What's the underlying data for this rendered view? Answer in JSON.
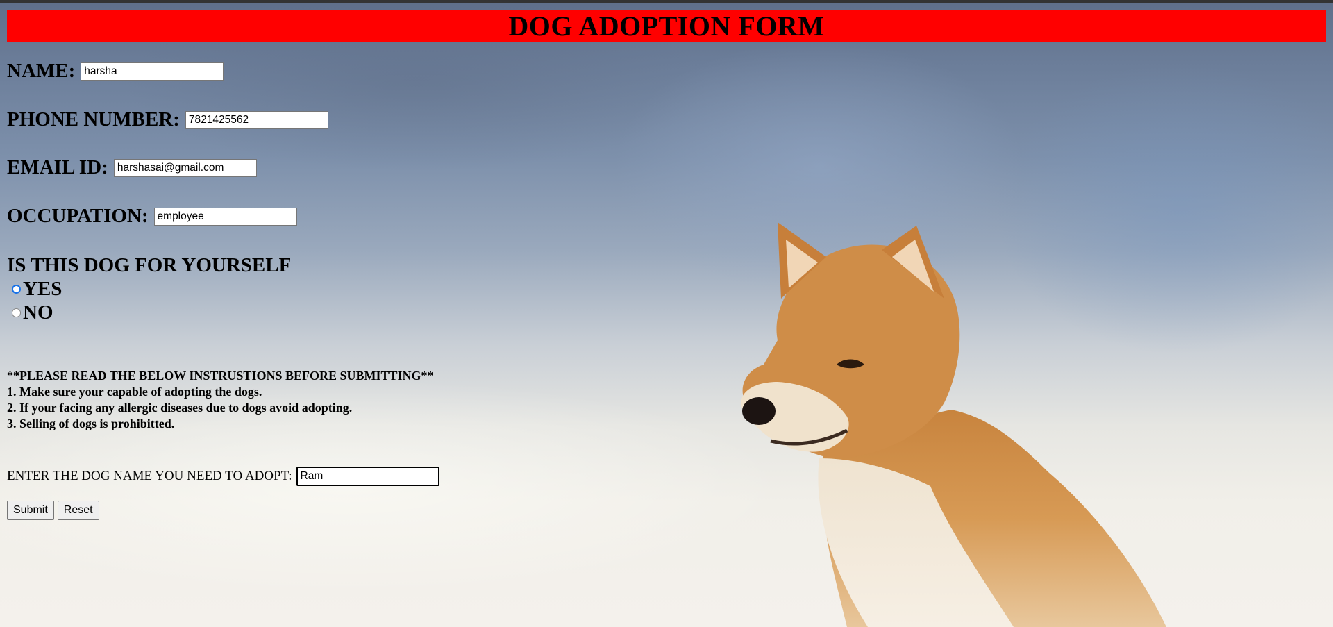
{
  "header": {
    "title": "DOG ADOPTION FORM"
  },
  "form": {
    "name": {
      "label": "NAME:",
      "value": "harsha"
    },
    "phone": {
      "label": "PHONE NUMBER:",
      "value": "7821425562"
    },
    "email": {
      "label": "EMAIL ID:",
      "value": "harshasai@gmail.com"
    },
    "occupation": {
      "label": "OCCUPATION:",
      "value": "employee"
    },
    "question": "IS THIS DOG FOR YOURSELF",
    "options": [
      {
        "label": "YES",
        "checked": true
      },
      {
        "label": "NO",
        "checked": false
      }
    ],
    "instructions": {
      "heading": "**PLEASE READ THE BELOW INSTRUSTIONS BEFORE SUBMITTING**",
      "items": [
        "1. Make sure your capable of adopting the dogs.",
        "2. If your facing any allergic diseases due to dogs avoid adopting.",
        "3. Selling of dogs is prohibitted."
      ]
    },
    "dog_name": {
      "label": "ENTER THE DOG NAME YOU NEED TO ADOPT:",
      "value": "Ram"
    },
    "submit_label": "Submit",
    "reset_label": "Reset"
  },
  "colors": {
    "header_bg": "#ff0000",
    "radio_accent": "#1a73e8"
  }
}
